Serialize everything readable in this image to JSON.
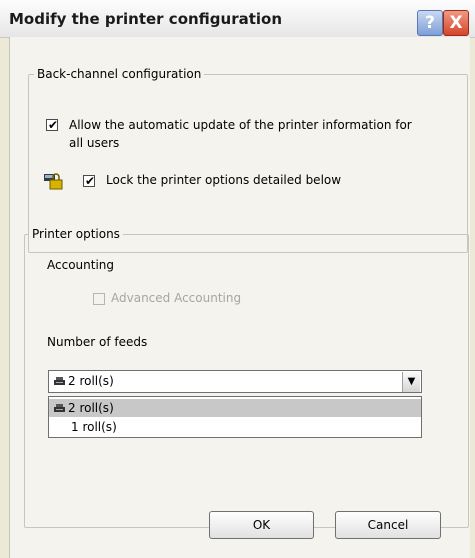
{
  "dialog": {
    "title": "Modify the printer configuration",
    "help_icon": "?",
    "close_icon": "X"
  },
  "back_channel": {
    "group_label": "Back-channel configuration",
    "auto_update": {
      "label_line1": "Allow the automatic update of the printer information for",
      "label_line2": "all users",
      "checked": true
    },
    "lock_options": {
      "label": "Lock the printer options detailed below",
      "checked": true,
      "icon": "lock-icon"
    }
  },
  "printer_options": {
    "group_label": "Printer options",
    "accounting_label": "Accounting",
    "advanced_accounting": {
      "label": "Advanced Accounting",
      "checked": false,
      "enabled": false
    },
    "feeds_label": "Number of feeds",
    "feeds_select": {
      "value": "2 roll(s)",
      "options": [
        "2 roll(s)",
        "1 roll(s)"
      ],
      "highlighted": "2 roll(s)",
      "icon": "printer-icon"
    }
  },
  "buttons": {
    "ok": "OK",
    "cancel": "Cancel"
  },
  "colors": {
    "title_bar": "#e6e6e6",
    "close_button": "#d4452a",
    "help_button": "#7d9ed6",
    "dialog_background": "#f4f3ee"
  }
}
